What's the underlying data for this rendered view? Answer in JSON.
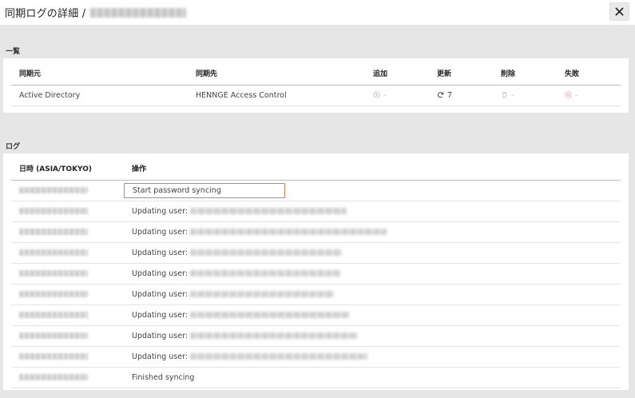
{
  "header": {
    "title": "同期ログの詳細 /"
  },
  "summary": {
    "section_label": "一覧",
    "columns": [
      "同期元",
      "同期先",
      "追加",
      "更新",
      "削除",
      "失敗"
    ],
    "row": {
      "source": "Active Directory",
      "destination": "HENNGE Access Control",
      "added": "-",
      "updated": "7",
      "deleted": "-",
      "failed": "-"
    }
  },
  "log": {
    "section_label": "ログ",
    "columns": [
      "日時 (ASIA/TOKYO)",
      "操作"
    ],
    "rows": [
      {
        "operation": "Start password syncing"
      },
      {
        "operation": "Updating user:"
      },
      {
        "operation": "Updating user:"
      },
      {
        "operation": "Updating user:"
      },
      {
        "operation": "Updating user:"
      },
      {
        "operation": "Updating user:"
      },
      {
        "operation": "Updating user:"
      },
      {
        "operation": "Updating user:"
      },
      {
        "operation": "Updating user:"
      },
      {
        "operation": "Finished syncing"
      }
    ]
  },
  "colors": {
    "highlight_border": "#e8764f",
    "background": "#e6e6e6"
  },
  "icons": {
    "added": "plus-circle-icon",
    "updated": "refresh-icon",
    "deleted": "trash-icon",
    "failed": "x-circle-icon",
    "close": "close-icon"
  }
}
